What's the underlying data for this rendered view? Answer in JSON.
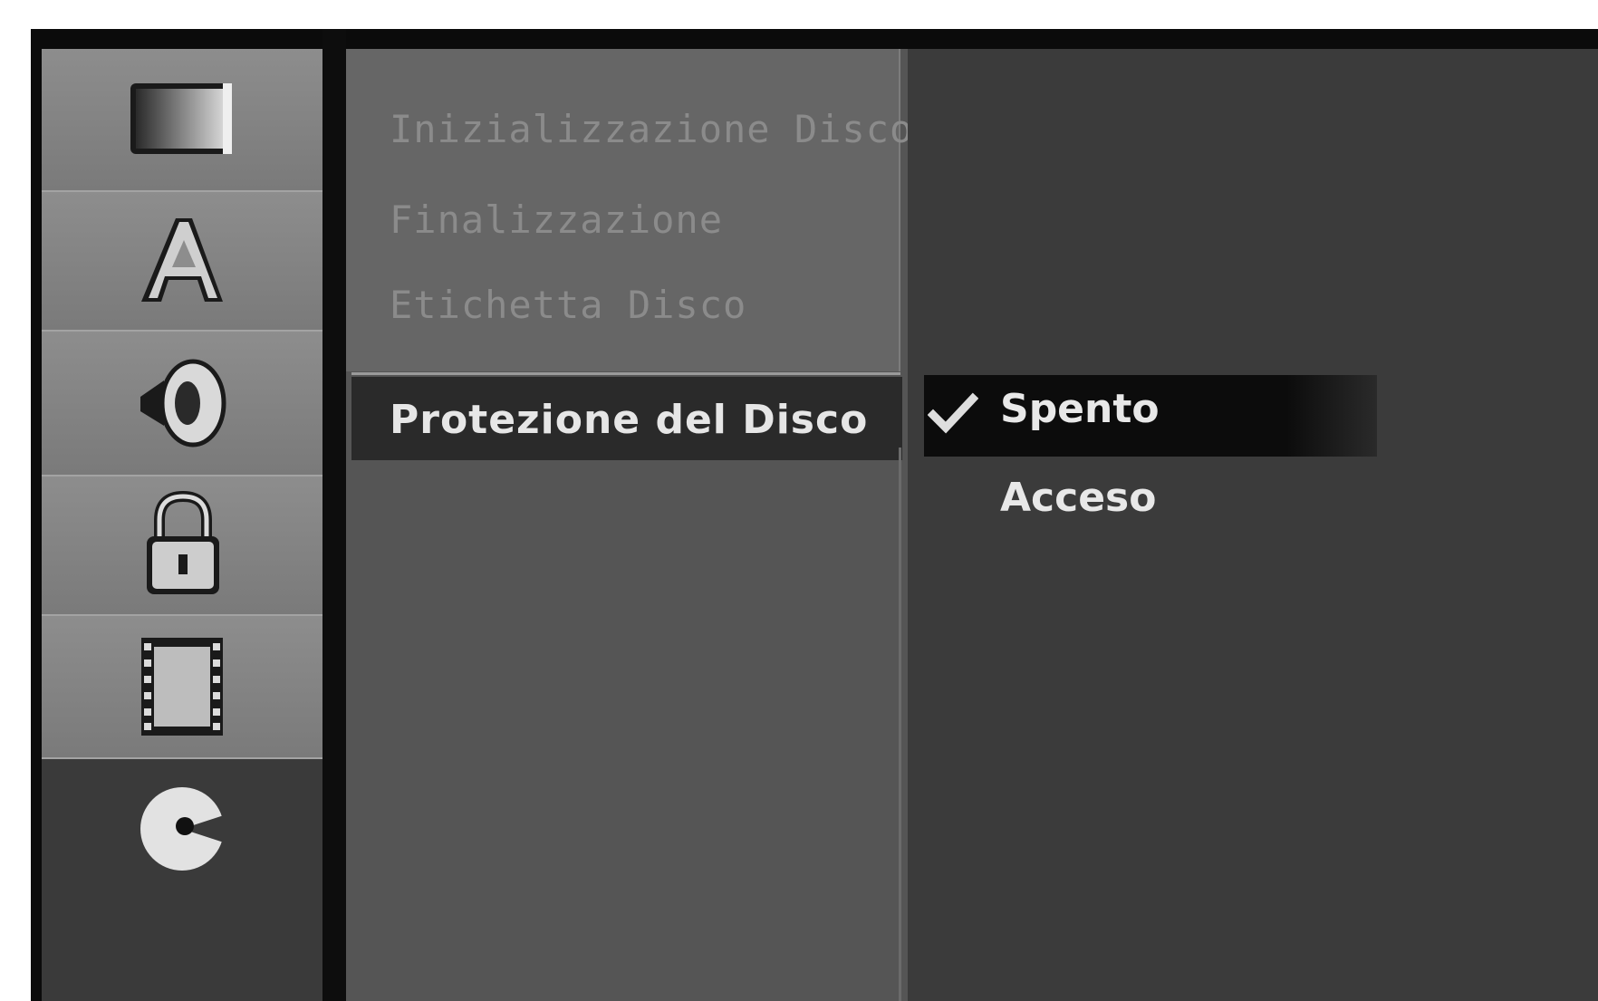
{
  "sidebar": {
    "icons": [
      {
        "name": "tv-screen-icon",
        "active": false
      },
      {
        "name": "language-a-icon",
        "active": false
      },
      {
        "name": "speaker-icon",
        "active": false
      },
      {
        "name": "padlock-icon",
        "active": false
      },
      {
        "name": "film-strip-icon",
        "active": false
      },
      {
        "name": "disc-icon",
        "active": true
      }
    ]
  },
  "menu": {
    "items": [
      {
        "label": "Inizializzazione Disco",
        "state": "disabled"
      },
      {
        "label": "Finalizzazione",
        "state": "disabled"
      },
      {
        "label": "Etichetta Disco",
        "state": "disabled"
      },
      {
        "label": "Protezione del Disco",
        "state": "selected"
      }
    ]
  },
  "options": {
    "items": [
      {
        "label": "Spento",
        "checked": true,
        "highlighted": true
      },
      {
        "label": "Acceso",
        "checked": false,
        "highlighted": false
      }
    ],
    "check_icon": "check-icon"
  },
  "colors": {
    "frame": "#0b0b0b",
    "icon_tile": "#8d8d8d",
    "menu_bg": "#555555",
    "options_bg": "#3b3b3b",
    "highlight": "#0c0c0c",
    "text_selected": "#e6e6e6",
    "text_disabled": "#8b8b8b"
  }
}
